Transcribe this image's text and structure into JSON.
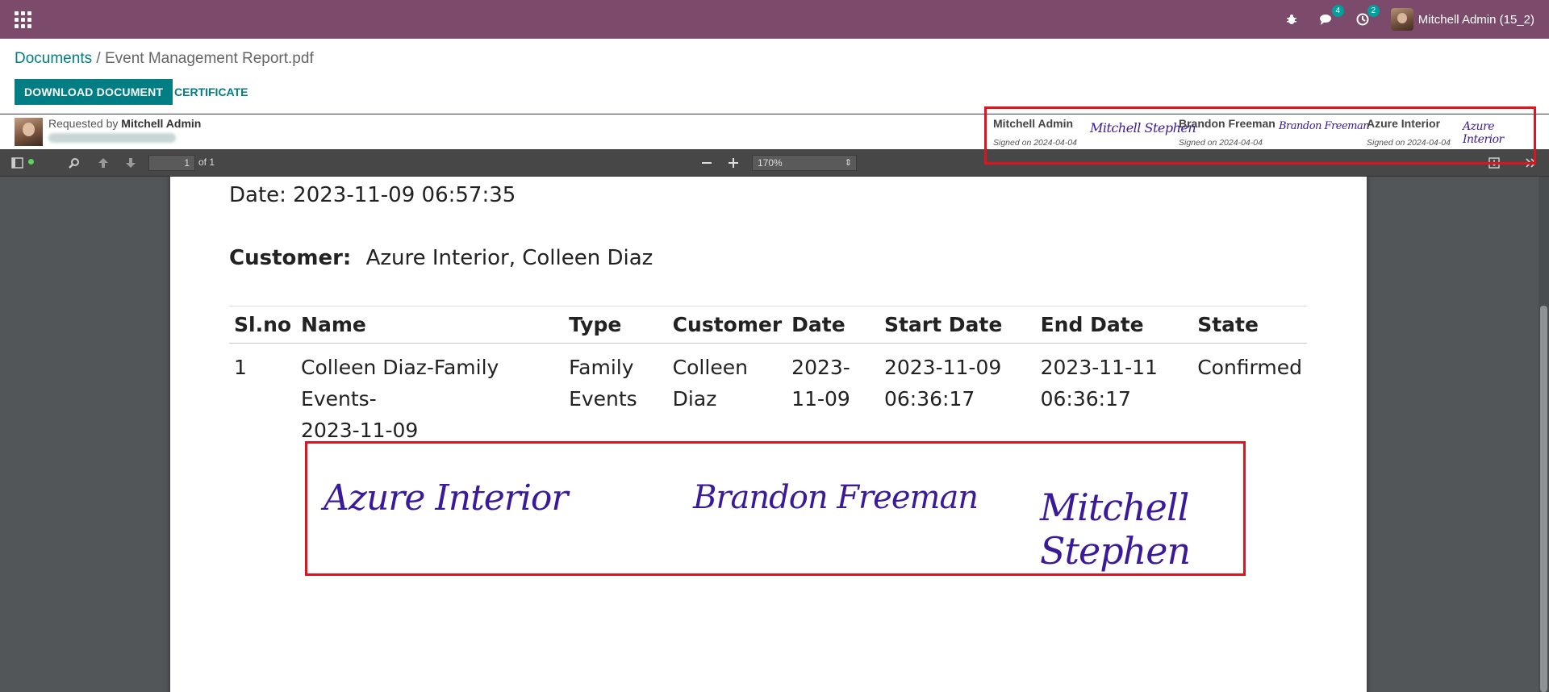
{
  "navbar": {
    "apps_icon": "apps-grid-icon",
    "debug_icon": "bug-icon",
    "messages_icon": "chat-icon",
    "messages_count": "4",
    "activities_icon": "clock-icon",
    "activities_count": "2",
    "user_name": "Mitchell Admin (15_2)"
  },
  "breadcrumb": {
    "root": "Documents",
    "separator": "/",
    "current": "Event Management Report.pdf"
  },
  "actions": {
    "download": "DOWNLOAD DOCUMENT",
    "certificate": "CERTIFICATE"
  },
  "request": {
    "label": "Requested by",
    "requester": "Mitchell Admin"
  },
  "signers": [
    {
      "name": "Mitchell Admin",
      "signed": "Signed on 2024-04-04",
      "signature": "Mitchell Stephen"
    },
    {
      "name": "Brandon Freeman",
      "signed": "Signed on 2024-04-04",
      "signature": "Brandon Freeman"
    },
    {
      "name": "Azure Interior",
      "signed": "Signed on 2024-04-04",
      "signature": "Azure Interior"
    }
  ],
  "pdf_toolbar": {
    "page_current": "1",
    "page_total": "of 1",
    "zoom": "170%"
  },
  "document": {
    "date_line": "Date: 2023-11-09 06:57:35",
    "customer_label": "Customer:",
    "customer_value": "Azure Interior, Colleen Diaz",
    "table": {
      "headers": [
        "Sl.no",
        "Name",
        "Type",
        "Customer",
        "Date",
        "Start Date",
        "End Date",
        "State"
      ],
      "rows": [
        {
          "slno": "1",
          "name_line1": "Colleen Diaz-Family Events-",
          "name_line2": "2023-11-09",
          "type_line1": "Family",
          "type_line2": "Events",
          "customer_line1": "Colleen",
          "customer_line2": "Diaz",
          "date_line1": "2023-",
          "date_line2": "11-09",
          "start_line1": "2023-11-09",
          "start_line2": "06:36:17",
          "end_line1": "2023-11-11",
          "end_line2": "06:36:17",
          "state": "Confirmed"
        }
      ]
    },
    "signatures": [
      "Azure Interior",
      "Brandon Freeman",
      "Mitchell Stephen"
    ]
  }
}
